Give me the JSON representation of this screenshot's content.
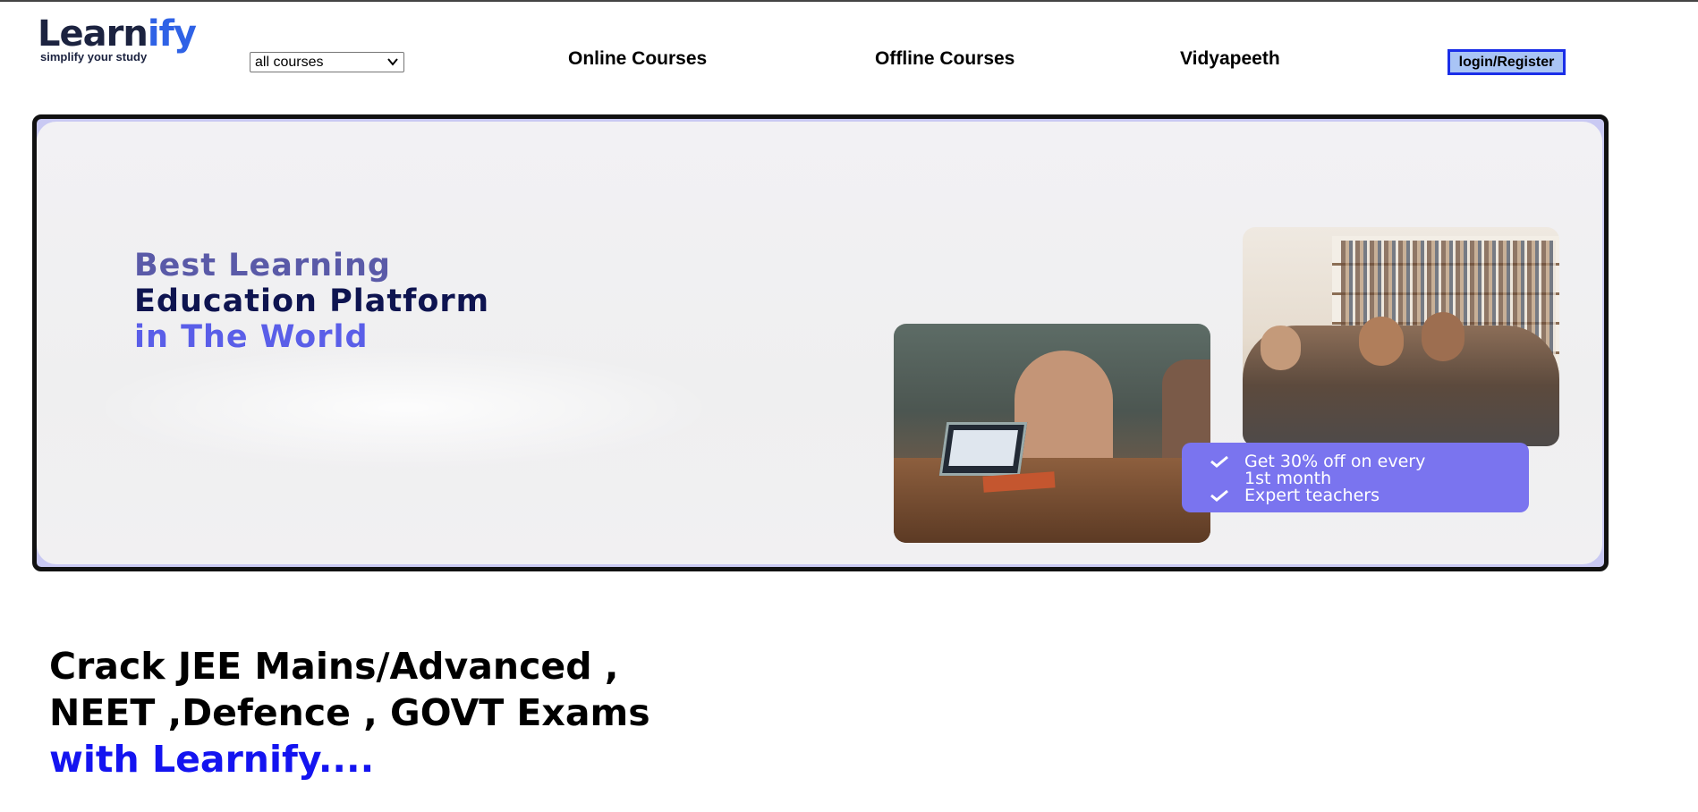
{
  "header": {
    "logo": {
      "part1": "Learn",
      "part2": "ify",
      "tagline": "simplify your study"
    },
    "course_select": {
      "selected": "all courses"
    },
    "nav": {
      "online": "Online Courses",
      "offline": "Offline Courses",
      "vidyapeeth": "Vidyapeeth"
    },
    "login_label": "login/Register"
  },
  "hero": {
    "line1": "Best Learning",
    "line2": "Education Platform",
    "line3": "in The World",
    "promo": {
      "item1": "Get 30% off on every",
      "item1b": "1st month",
      "item2": "Expert teachers"
    }
  },
  "tagline": {
    "line1": "Crack JEE Mains/Advanced ,",
    "line2": "NEET ,Defence , GOVT Exams",
    "line3": "with Learnify...."
  },
  "colors": {
    "logo_dark": "#1c2340",
    "logo_blue": "#2f62e6",
    "login_bg": "#a9c4f5",
    "login_border": "#1a2ee8",
    "promo_bg": "#7a74ef",
    "tagline_blue": "#1414f0"
  },
  "icons": {
    "select_arrow": "chevron-down-icon",
    "promo_check": "check-icon"
  }
}
